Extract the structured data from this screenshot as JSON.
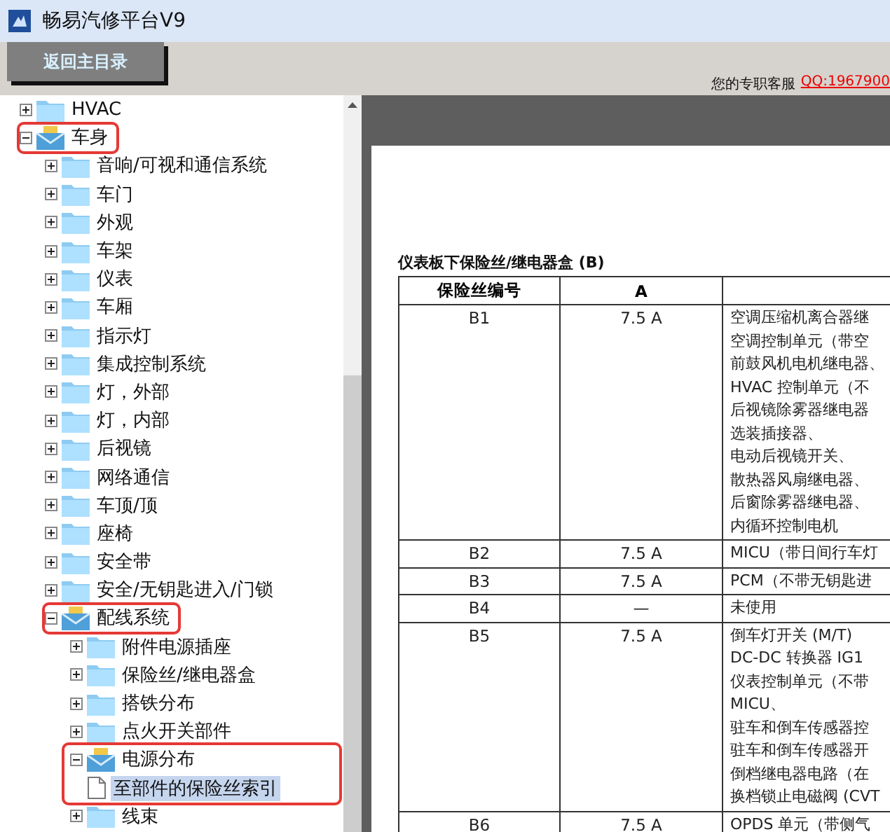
{
  "window": {
    "title": "畅易汽修平台V9"
  },
  "toolbar": {
    "back_button": "返回主目录",
    "support_label": "您的专职客服",
    "support_link": "QQ:1967900"
  },
  "tree": [
    {
      "label": "HVAC",
      "kind": "folder",
      "expanded": false,
      "selected": false
    },
    {
      "label": "车身",
      "kind": "folder",
      "expanded": true,
      "selected": false,
      "highlighted": true,
      "children": [
        {
          "label": "音响/可视和通信系统",
          "kind": "folder",
          "expanded": false,
          "selected": false
        },
        {
          "label": "车门",
          "kind": "folder",
          "expanded": false,
          "selected": false
        },
        {
          "label": "外观",
          "kind": "folder",
          "expanded": false,
          "selected": false
        },
        {
          "label": "车架",
          "kind": "folder",
          "expanded": false,
          "selected": false
        },
        {
          "label": "仪表",
          "kind": "folder",
          "expanded": false,
          "selected": false
        },
        {
          "label": "车厢",
          "kind": "folder",
          "expanded": false,
          "selected": false
        },
        {
          "label": "指示灯",
          "kind": "folder",
          "expanded": false,
          "selected": false
        },
        {
          "label": "集成控制系统",
          "kind": "folder",
          "expanded": false,
          "selected": false
        },
        {
          "label": "灯，外部",
          "kind": "folder",
          "expanded": false,
          "selected": false
        },
        {
          "label": "灯，内部",
          "kind": "folder",
          "expanded": false,
          "selected": false
        },
        {
          "label": "后视镜",
          "kind": "folder",
          "expanded": false,
          "selected": false
        },
        {
          "label": "网络通信",
          "kind": "folder",
          "expanded": false,
          "selected": false
        },
        {
          "label": "车顶/顶",
          "kind": "folder",
          "expanded": false,
          "selected": false
        },
        {
          "label": "座椅",
          "kind": "folder",
          "expanded": false,
          "selected": false
        },
        {
          "label": "安全带",
          "kind": "folder",
          "expanded": false,
          "selected": false
        },
        {
          "label": "安全/无钥匙进入/门锁",
          "kind": "folder",
          "expanded": false,
          "selected": false
        },
        {
          "label": "配线系统",
          "kind": "folder",
          "expanded": true,
          "selected": false,
          "highlighted": true,
          "children": [
            {
              "label": "附件电源插座",
              "kind": "folder",
              "expanded": false,
              "selected": false
            },
            {
              "label": "保险丝/继电器盒",
              "kind": "folder",
              "expanded": false,
              "selected": false
            },
            {
              "label": "搭铁分布",
              "kind": "folder",
              "expanded": false,
              "selected": false
            },
            {
              "label": "点火开关部件",
              "kind": "folder",
              "expanded": false,
              "selected": false
            },
            {
              "label": "电源分布",
              "kind": "folder",
              "expanded": true,
              "selected": false,
              "highlighted_branch": true,
              "children": [
                {
                  "label": "至部件的保险丝索引",
                  "kind": "document",
                  "selected": true
                }
              ]
            },
            {
              "label": "线束",
              "kind": "folder",
              "expanded": false,
              "selected": false
            }
          ]
        }
      ]
    }
  ],
  "document": {
    "table_title": "仪表板下保险丝/继电器盒 (B)",
    "columns": [
      "保险丝编号",
      "A"
    ],
    "rows": [
      {
        "fuse": "B1",
        "amps": "7.5 A",
        "circuits": [
          "空调压缩机离合器继",
          "空调控制单元（带空",
          "前鼓风机电机继电器、",
          "HVAC 控制单元（不",
          "后视镜除雾器继电器",
          "选装插接器、",
          "电动后视镜开关、",
          "散热器风扇继电器、",
          "后窗除雾器继电器、",
          "内循环控制电机"
        ]
      },
      {
        "fuse": "B2",
        "amps": "7.5 A",
        "circuits": [
          "MICU（带日间行车灯"
        ]
      },
      {
        "fuse": "B3",
        "amps": "7.5 A",
        "circuits": [
          "PCM（不带无钥匙进"
        ]
      },
      {
        "fuse": "B4",
        "amps": "—",
        "circuits": [
          "未使用"
        ]
      },
      {
        "fuse": "B5",
        "amps": "7.5 A",
        "circuits": [
          "倒车灯开关 (M/T)",
          "DC-DC 转换器 IG1",
          "仪表控制单元（不带",
          "MICU、",
          "驻车和倒车传感器控",
          "驻车和倒车传感器开",
          "倒档继电器电路（在",
          "换档锁止电磁阀 (CVT"
        ]
      },
      {
        "fuse": "B6",
        "amps": "7.5 A",
        "circuits": [
          "OPDS 单元（带侧气"
        ]
      }
    ]
  }
}
